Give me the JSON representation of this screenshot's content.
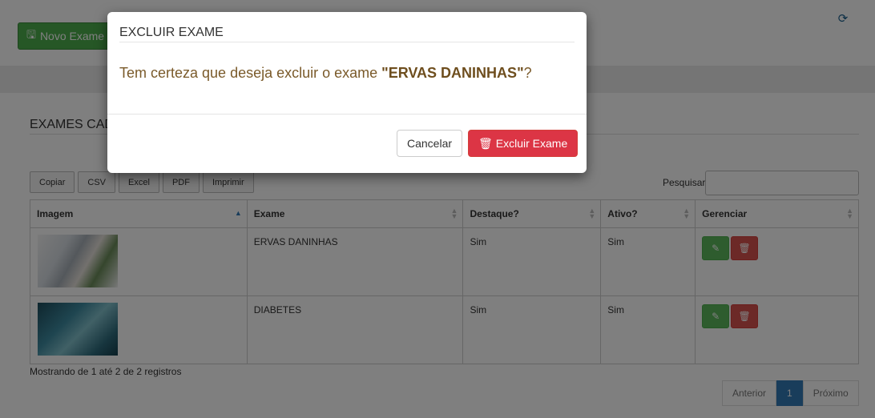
{
  "toolbar": {
    "new_exam_label": "Novo Exame"
  },
  "section": {
    "title": "EXAMES CADASTRADOS"
  },
  "export_buttons": [
    "Copiar",
    "CSV",
    "Excel",
    "PDF",
    "Imprimir"
  ],
  "search": {
    "label": "Pesquisar",
    "value": ""
  },
  "table": {
    "columns": [
      "Imagem",
      "Exame",
      "Destaque?",
      "Ativo?",
      "Gerenciar"
    ],
    "rows": [
      {
        "exam": "ERVAS DANINHAS",
        "highlight": "Sim",
        "active": "Sim"
      },
      {
        "exam": "DIABETES",
        "highlight": "Sim",
        "active": "Sim"
      }
    ]
  },
  "info": "Mostrando de 1 até 2 de 2 registros",
  "pagination": {
    "prev": "Anterior",
    "current": "1",
    "next": "Próximo"
  },
  "modal": {
    "title": "EXCLUIR EXAME",
    "message_prefix": "Tem certeza que deseja excluir o exame ",
    "message_item": "\"ERVAS DANINHAS\"",
    "message_suffix": "?",
    "cancel_label": "Cancelar",
    "confirm_label": "Excluir Exame"
  },
  "colors": {
    "primary": "#337ab7",
    "success": "#5cb85c",
    "danger": "#dc3545"
  },
  "icons": [
    "save-icon",
    "refresh-icon",
    "edit-icon",
    "trash-icon",
    "sort-icon"
  ]
}
